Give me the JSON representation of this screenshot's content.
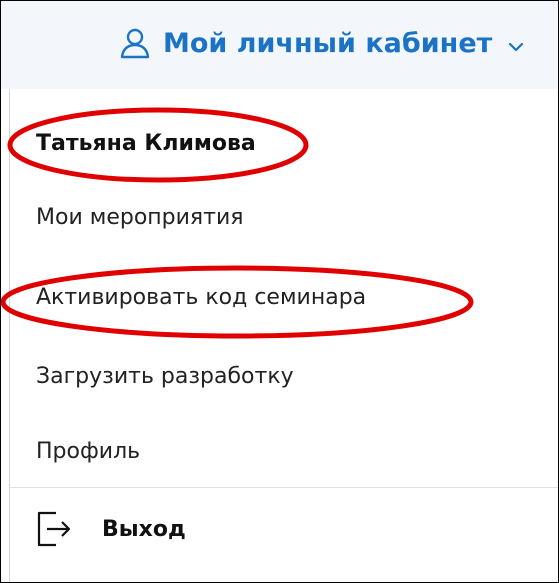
{
  "header": {
    "account_label": "Мой личный кабинет",
    "user_icon": "user-icon",
    "chevron_icon": "chevron-down-icon"
  },
  "menu": {
    "user_name": "Татьяна Климова",
    "items": [
      {
        "label": "Мои мероприятия"
      },
      {
        "label": "Активировать код семинара"
      },
      {
        "label": "Загрузить разработку"
      },
      {
        "label": "Профиль"
      }
    ],
    "logout_label": "Выход",
    "logout_icon": "logout-icon"
  },
  "annotations": {
    "highlight_color": "#e00000"
  },
  "colors": {
    "accent": "#1a73c5",
    "header_bg": "#f3f6fb"
  }
}
